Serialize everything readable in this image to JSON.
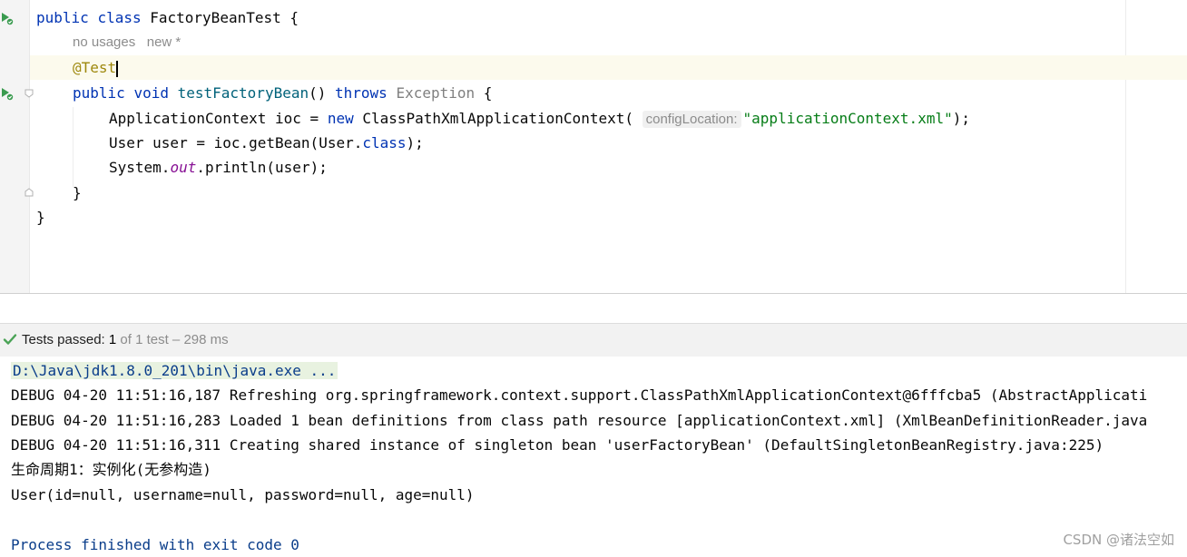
{
  "editor": {
    "class_decl": {
      "kw1": "public",
      "kw2": "class",
      "name": "FactoryBeanTest",
      "brace": "{"
    },
    "usages_hint": "no usages",
    "author_hint": "new *",
    "annotation": "@Test",
    "method_decl": {
      "kw1": "public",
      "kw2": "void",
      "name": "testFactoryBean",
      "params": "()",
      "throws_kw": "throws",
      "exception": "Exception",
      "brace": "{"
    },
    "line_ctx": {
      "prefix": "ApplicationContext ioc = ",
      "new_kw": "new",
      "ctor": " ClassPathXmlApplicationContext(",
      "param_hint": "configLocation:",
      "arg": "\"applicationContext.xml\"",
      "suffix": ");"
    },
    "line_user": {
      "prefix": "User user = ioc.getBean(User.",
      "class_kw": "class",
      "suffix": ");"
    },
    "line_print": {
      "prefix": "System.",
      "field": "out",
      "suffix": ".println(user);"
    },
    "method_close": "}",
    "class_close": "}"
  },
  "tests_bar": {
    "label": "Tests passed: ",
    "count": "1",
    "detail": " of 1 test – 298 ms"
  },
  "console": {
    "lines": [
      "D:\\Java\\jdk1.8.0_201\\bin\\java.exe ...",
      "DEBUG 04-20 11:51:16,187 Refreshing org.springframework.context.support.ClassPathXmlApplicationContext@6fffcba5 (AbstractApplicati",
      "DEBUG 04-20 11:51:16,283 Loaded 1 bean definitions from class path resource [applicationContext.xml] (XmlBeanDefinitionReader.java",
      "DEBUG 04-20 11:51:16,311 Creating shared instance of singleton bean 'userFactoryBean' (DefaultSingletonBeanRegistry.java:225)",
      "生命周期1：实例化(无参构造)",
      "User(id=null, username=null, password=null, age=null)",
      "Process finished with exit code 0"
    ]
  },
  "watermark": "CSDN @诸法空如",
  "icons": {
    "run_class": "run-gutter-icon",
    "run_method": "run-gutter-icon",
    "fold": "fold-icon",
    "passed": "check-icon"
  },
  "colors": {
    "keyword": "#0033b3",
    "annotation": "#9e880d",
    "string": "#067d17",
    "method": "#00627a",
    "static_field": "#871094",
    "pass_green": "#4aa356"
  }
}
